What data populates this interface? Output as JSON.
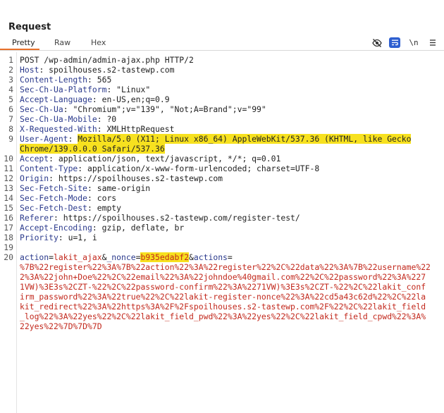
{
  "panel": {
    "title": "Request",
    "tabs": [
      "Pretty",
      "Raw",
      "Hex"
    ],
    "active_tab": "Pretty",
    "tools": {
      "eye_icon": "eye-slash-icon",
      "wrap_icon": "wrap-lines-icon",
      "newline_label": "\\n",
      "menu_icon": "hamburger-menu-icon"
    }
  },
  "request": {
    "line_numbers": [
      "1",
      "2",
      "3",
      "4",
      "5",
      "6",
      "7",
      "8",
      "9",
      "10",
      "11",
      "12",
      "13",
      "14",
      "15",
      "16",
      "17",
      "18",
      "19",
      "20"
    ],
    "request_line": "POST /wp-admin/admin-ajax.php HTTP/2",
    "headers": [
      {
        "name": "Host",
        "value": "spoilhouses.s2-tastewp.com"
      },
      {
        "name": "Content-Length",
        "value": "565"
      },
      {
        "name": "Sec-Ch-Ua-Platform",
        "value": "\"Linux\""
      },
      {
        "name": "Accept-Language",
        "value": "en-US,en;q=0.9"
      },
      {
        "name": "Sec-Ch-Ua",
        "value": "\"Chromium\";v=\"139\", \"Not;A=Brand\";v=\"99\""
      },
      {
        "name": "Sec-Ch-Ua-Mobile",
        "value": "?0"
      },
      {
        "name": "X-Requested-With",
        "value": "XMLHttpRequest"
      },
      {
        "name": "User-Agent",
        "value": "Mozilla/5.0 (X11; Linux x86_64) AppleWebKit/537.36 (KHTML, like Gecko",
        "value_cont": "Chrome/139.0.0.0 Safari/537.36"
      },
      {
        "name": "Accept",
        "value": "application/json, text/javascript, */*; q=0.01"
      },
      {
        "name": "Content-Type",
        "value": "application/x-www-form-urlencoded; charset=UTF-8"
      },
      {
        "name": "Origin",
        "value": "https://spoilhouses.s2-tastewp.com"
      },
      {
        "name": "Sec-Fetch-Site",
        "value": "same-origin"
      },
      {
        "name": "Sec-Fetch-Mode",
        "value": "cors"
      },
      {
        "name": "Sec-Fetch-Dest",
        "value": "empty"
      },
      {
        "name": "Referer",
        "value": "https://spoilhouses.s2-tastewp.com/register-test/"
      },
      {
        "name": "Accept-Encoding",
        "value": "gzip, deflate, br"
      },
      {
        "name": "Priority",
        "value": "u=1, i"
      }
    ],
    "body": {
      "p1_key": "action",
      "p1_value": "lakit_ajax",
      "p2_key": "_nonce",
      "p2_value": "b935edabf2",
      "p3_key": "actions",
      "lines": [
        "%7B%22register%22%3A%7B%22action%22%3A%22register%22%2C%22data%22%3A%7B%22username%22",
        "2%3A%22john+Doe%22%2C%22email%22%3A%22johndoe%40gmail.com%22%2C%22password%22%3A%227",
        "1VW)%3E3s%2CZT-%22%2C%22password-confirm%22%3A%2271VW)%3E3s%2CZT-%22%2C%22lakit_conf",
        "irm_password%22%3A%22true%22%2C%22lakit-register-nonce%22%3A%22cd5a43c62d%22%2C%22la",
        "kit_redirect%22%3A%22https%3A%2F%2Fspoilhouses.s2-tastewp.com%2F%22%2C%22lakit_field",
        "_log%22%3A%22yes%22%2C%22lakit_field_pwd%22%3A%22yes%22%2C%22lakit_field_cpwd%22%3A%",
        "22yes%22%7D%7D%7D"
      ]
    }
  }
}
